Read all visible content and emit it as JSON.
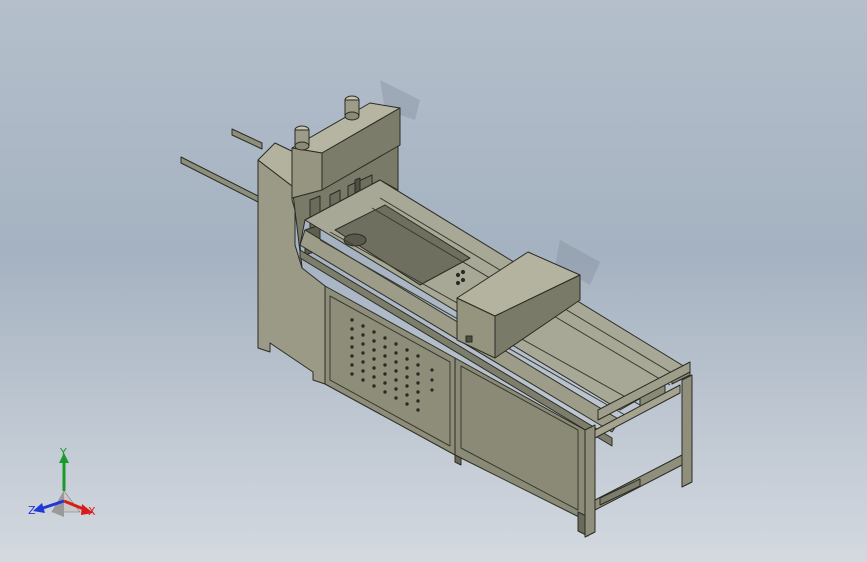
{
  "viewport": {
    "background_top": "#b4bfcb",
    "background_bottom": "#d4d9e0"
  },
  "model": {
    "body_color": "#8a8a78",
    "edge_color": "#2b2b24"
  },
  "triad": {
    "x_label": "X",
    "y_label": "Y",
    "z_label": "Z",
    "x_color": "#d81c1c",
    "y_color": "#1a9a2a",
    "z_color": "#2238d6"
  }
}
